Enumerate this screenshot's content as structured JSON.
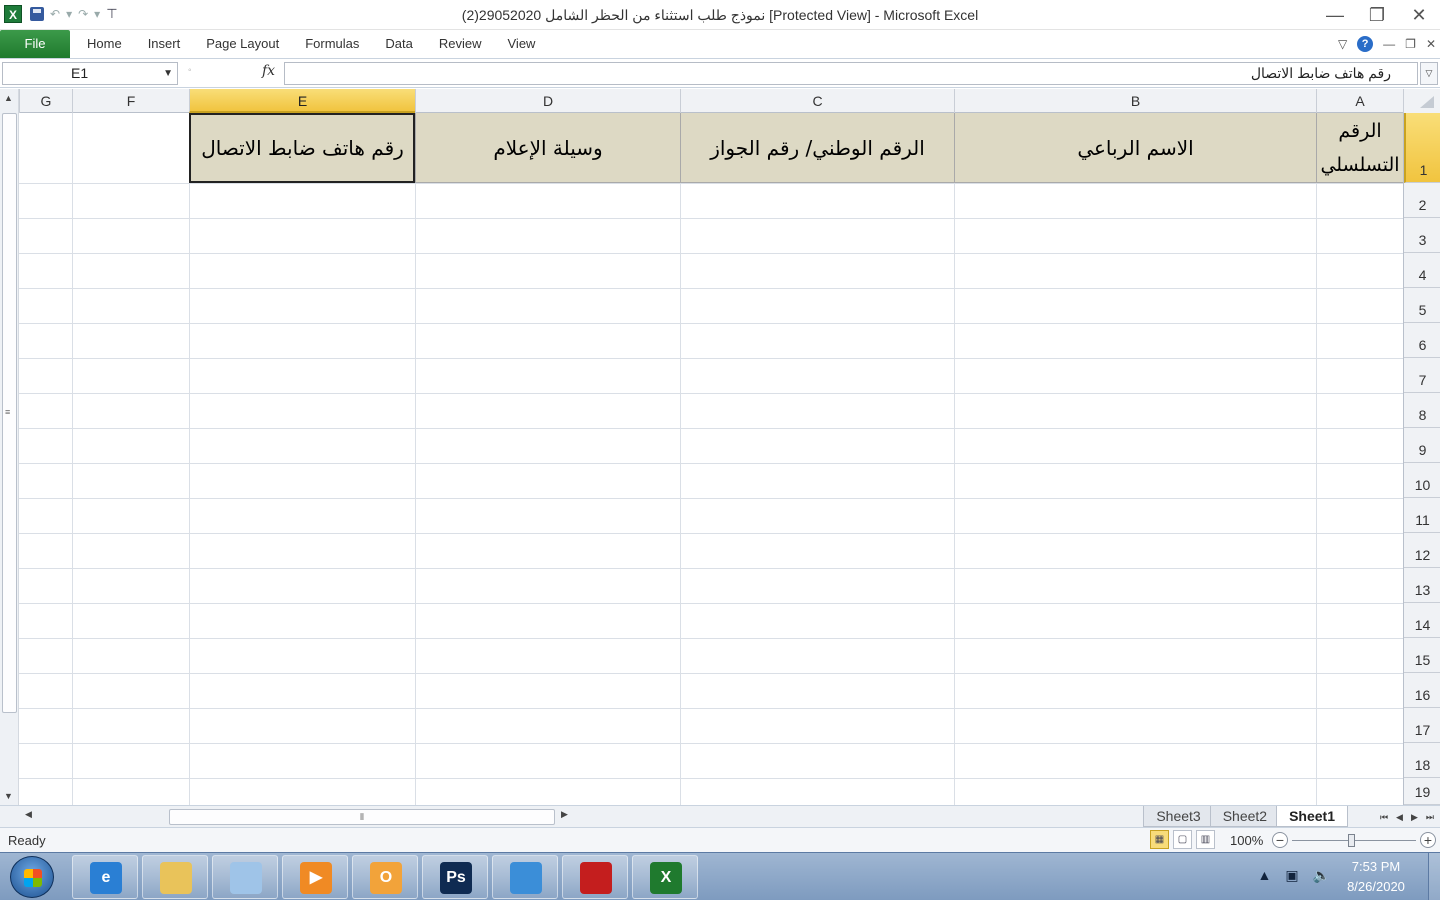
{
  "window": {
    "title": "نموذج طلب استثناء من الحظر الشامل 29052020(2)  [Protected View]  -  Microsoft Excel",
    "app_icon": "X",
    "minimize": "—",
    "restore": "❐",
    "close": "✕"
  },
  "quick_access": {
    "save_icon": "save-icon",
    "undo": "↶",
    "undo_dd": "▾",
    "redo": "↷",
    "redo_dd": "▾",
    "customize": "⊤"
  },
  "ribbon": {
    "file_label": "File",
    "tabs": [
      "Home",
      "Insert",
      "Page Layout",
      "Formulas",
      "Data",
      "Review",
      "View"
    ],
    "collapse": "▽",
    "help": "?",
    "wb_min": "—",
    "wb_restore": "❐",
    "wb_close": "✕"
  },
  "formula_bar": {
    "name_box": "E1",
    "name_dd": "▼",
    "dots": "◦",
    "fx": "fx",
    "value": "رقم هاتف ضابط الاتصال",
    "expand": "▽"
  },
  "columns": [
    "G",
    "F",
    "E",
    "D",
    "C",
    "B",
    "A"
  ],
  "selected_column": "E",
  "header_row": {
    "A": "الرقم التسلسلي",
    "B": "الاسم الرباعي",
    "C": "الرقم الوطني/ رقم الجواز",
    "D": "وسيلة الإعلام",
    "E": "رقم هاتف ضابط الاتصال"
  },
  "rows": [
    "1",
    "2",
    "3",
    "4",
    "5",
    "6",
    "7",
    "8",
    "9",
    "10",
    "11",
    "12",
    "13",
    "14",
    "15",
    "16",
    "17",
    "18",
    "19"
  ],
  "sheet_tabs": [
    "Sheet3",
    "Sheet2",
    "Sheet1"
  ],
  "active_sheet": "Sheet1",
  "tab_nav": [
    "⏮",
    "◀",
    "▶",
    "⏭"
  ],
  "status": {
    "ready": "Ready",
    "zoom": "100%",
    "zoom_minus": "−",
    "zoom_plus": "+",
    "zoom_value": 1.0
  },
  "taskbar": {
    "apps": [
      {
        "name": "internet-explorer",
        "glyph": "e",
        "color": "#2a7fd4"
      },
      {
        "name": "file-explorer",
        "glyph": "",
        "color": "#e9c35a"
      },
      {
        "name": "notepad",
        "glyph": "",
        "color": "#9fc4e8"
      },
      {
        "name": "media-player",
        "glyph": "▶",
        "color": "#f08a24"
      },
      {
        "name": "outlook",
        "glyph": "O",
        "color": "#f2a33a"
      },
      {
        "name": "photoshop",
        "glyph": "Ps",
        "color": "#0f2b52"
      },
      {
        "name": "chrome",
        "glyph": "",
        "color": "#3b8ed8"
      },
      {
        "name": "adobe-acrobat",
        "glyph": "",
        "color": "#c41e1e"
      },
      {
        "name": "excel",
        "glyph": "X",
        "color": "#1f7a2e"
      }
    ],
    "time": "7:53 PM",
    "date": "8/26/2020",
    "tray_up": "▲",
    "tray_net": "▣",
    "tray_vol": "🔈"
  }
}
